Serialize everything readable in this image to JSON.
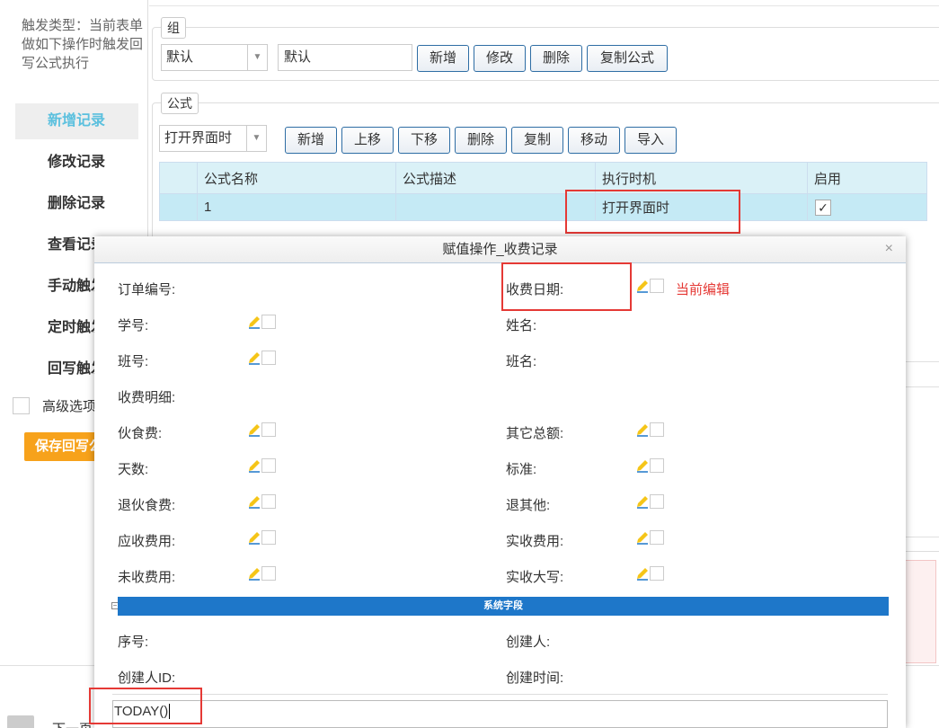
{
  "left": {
    "trigger_desc": "触发类型：当前表单做如下操作时触发回写公式执行",
    "nav": [
      "新增记录",
      "修改记录",
      "删除记录",
      "查看记录",
      "手动触发",
      "定时触发",
      "回写触发"
    ],
    "advanced_label": "高级选项",
    "save_label": "保存回写公式"
  },
  "group": {
    "legend": "组",
    "select_value": "默认",
    "input_value": "默认",
    "buttons": [
      "新增",
      "修改",
      "删除",
      "复制公式"
    ]
  },
  "formula": {
    "legend": "公式",
    "select_value": "打开界面时",
    "buttons": [
      "新增",
      "上移",
      "下移",
      "删除",
      "复制",
      "移动",
      "导入"
    ],
    "columns": [
      "公式名称",
      "公式描述",
      "执行时机",
      "启用"
    ],
    "rows": [
      {
        "name": "1",
        "desc": "",
        "timing": "打开界面时",
        "enabled": "✓"
      }
    ]
  },
  "modal": {
    "title": "赋值操作_收费记录",
    "close": "×",
    "current_edit": "当前编辑",
    "fields": {
      "order_no": "订单编号:",
      "pay_date": "收费日期:",
      "student_no": "学号:",
      "name": "姓名:",
      "class_no": "班号:",
      "class_name": "班名:",
      "detail": "收费明细:",
      "meal_fee": "伙食费:",
      "other_total": "其它总额:",
      "days": "天数:",
      "standard": "标准:",
      "refund_meal": "退伙食费:",
      "refund_other": "退其他:",
      "receivable": "应收费用:",
      "received": "实收费用:",
      "unpaid": "未收费用:",
      "received_caps": "实收大写:",
      "seq": "序号:",
      "creator": "创建人:",
      "creator_id": "创建人ID:",
      "created_time": "创建时间:"
    },
    "system_section": "系统字段",
    "formula_text": "TODAY()"
  },
  "pager": {
    "text": "下一页"
  },
  "colors": {
    "accent": "#5bc0de",
    "save": "#f7a21b",
    "sys_bar": "#1e77c9",
    "highlight": "#e53935"
  }
}
